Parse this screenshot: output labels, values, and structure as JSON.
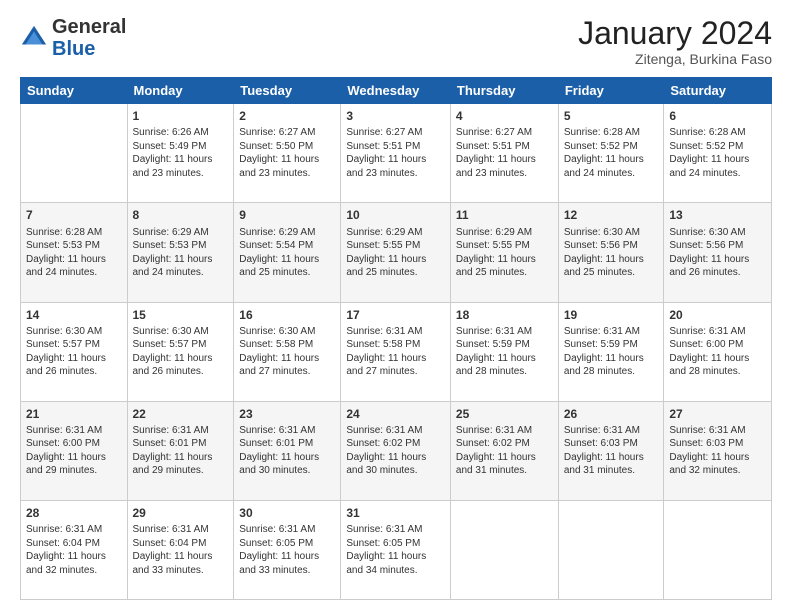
{
  "header": {
    "logo_general": "General",
    "logo_blue": "Blue",
    "month_title": "January 2024",
    "location": "Zitenga, Burkina Faso"
  },
  "days_of_week": [
    "Sunday",
    "Monday",
    "Tuesday",
    "Wednesday",
    "Thursday",
    "Friday",
    "Saturday"
  ],
  "weeks": [
    [
      {
        "day": "",
        "info": ""
      },
      {
        "day": "1",
        "info": "Sunrise: 6:26 AM\nSunset: 5:49 PM\nDaylight: 11 hours\nand 23 minutes."
      },
      {
        "day": "2",
        "info": "Sunrise: 6:27 AM\nSunset: 5:50 PM\nDaylight: 11 hours\nand 23 minutes."
      },
      {
        "day": "3",
        "info": "Sunrise: 6:27 AM\nSunset: 5:51 PM\nDaylight: 11 hours\nand 23 minutes."
      },
      {
        "day": "4",
        "info": "Sunrise: 6:27 AM\nSunset: 5:51 PM\nDaylight: 11 hours\nand 23 minutes."
      },
      {
        "day": "5",
        "info": "Sunrise: 6:28 AM\nSunset: 5:52 PM\nDaylight: 11 hours\nand 24 minutes."
      },
      {
        "day": "6",
        "info": "Sunrise: 6:28 AM\nSunset: 5:52 PM\nDaylight: 11 hours\nand 24 minutes."
      }
    ],
    [
      {
        "day": "7",
        "info": "Sunrise: 6:28 AM\nSunset: 5:53 PM\nDaylight: 11 hours\nand 24 minutes."
      },
      {
        "day": "8",
        "info": "Sunrise: 6:29 AM\nSunset: 5:53 PM\nDaylight: 11 hours\nand 24 minutes."
      },
      {
        "day": "9",
        "info": "Sunrise: 6:29 AM\nSunset: 5:54 PM\nDaylight: 11 hours\nand 25 minutes."
      },
      {
        "day": "10",
        "info": "Sunrise: 6:29 AM\nSunset: 5:55 PM\nDaylight: 11 hours\nand 25 minutes."
      },
      {
        "day": "11",
        "info": "Sunrise: 6:29 AM\nSunset: 5:55 PM\nDaylight: 11 hours\nand 25 minutes."
      },
      {
        "day": "12",
        "info": "Sunrise: 6:30 AM\nSunset: 5:56 PM\nDaylight: 11 hours\nand 25 minutes."
      },
      {
        "day": "13",
        "info": "Sunrise: 6:30 AM\nSunset: 5:56 PM\nDaylight: 11 hours\nand 26 minutes."
      }
    ],
    [
      {
        "day": "14",
        "info": "Sunrise: 6:30 AM\nSunset: 5:57 PM\nDaylight: 11 hours\nand 26 minutes."
      },
      {
        "day": "15",
        "info": "Sunrise: 6:30 AM\nSunset: 5:57 PM\nDaylight: 11 hours\nand 26 minutes."
      },
      {
        "day": "16",
        "info": "Sunrise: 6:30 AM\nSunset: 5:58 PM\nDaylight: 11 hours\nand 27 minutes."
      },
      {
        "day": "17",
        "info": "Sunrise: 6:31 AM\nSunset: 5:58 PM\nDaylight: 11 hours\nand 27 minutes."
      },
      {
        "day": "18",
        "info": "Sunrise: 6:31 AM\nSunset: 5:59 PM\nDaylight: 11 hours\nand 28 minutes."
      },
      {
        "day": "19",
        "info": "Sunrise: 6:31 AM\nSunset: 5:59 PM\nDaylight: 11 hours\nand 28 minutes."
      },
      {
        "day": "20",
        "info": "Sunrise: 6:31 AM\nSunset: 6:00 PM\nDaylight: 11 hours\nand 28 minutes."
      }
    ],
    [
      {
        "day": "21",
        "info": "Sunrise: 6:31 AM\nSunset: 6:00 PM\nDaylight: 11 hours\nand 29 minutes."
      },
      {
        "day": "22",
        "info": "Sunrise: 6:31 AM\nSunset: 6:01 PM\nDaylight: 11 hours\nand 29 minutes."
      },
      {
        "day": "23",
        "info": "Sunrise: 6:31 AM\nSunset: 6:01 PM\nDaylight: 11 hours\nand 30 minutes."
      },
      {
        "day": "24",
        "info": "Sunrise: 6:31 AM\nSunset: 6:02 PM\nDaylight: 11 hours\nand 30 minutes."
      },
      {
        "day": "25",
        "info": "Sunrise: 6:31 AM\nSunset: 6:02 PM\nDaylight: 11 hours\nand 31 minutes."
      },
      {
        "day": "26",
        "info": "Sunrise: 6:31 AM\nSunset: 6:03 PM\nDaylight: 11 hours\nand 31 minutes."
      },
      {
        "day": "27",
        "info": "Sunrise: 6:31 AM\nSunset: 6:03 PM\nDaylight: 11 hours\nand 32 minutes."
      }
    ],
    [
      {
        "day": "28",
        "info": "Sunrise: 6:31 AM\nSunset: 6:04 PM\nDaylight: 11 hours\nand 32 minutes."
      },
      {
        "day": "29",
        "info": "Sunrise: 6:31 AM\nSunset: 6:04 PM\nDaylight: 11 hours\nand 33 minutes."
      },
      {
        "day": "30",
        "info": "Sunrise: 6:31 AM\nSunset: 6:05 PM\nDaylight: 11 hours\nand 33 minutes."
      },
      {
        "day": "31",
        "info": "Sunrise: 6:31 AM\nSunset: 6:05 PM\nDaylight: 11 hours\nand 34 minutes."
      },
      {
        "day": "",
        "info": ""
      },
      {
        "day": "",
        "info": ""
      },
      {
        "day": "",
        "info": ""
      }
    ]
  ]
}
